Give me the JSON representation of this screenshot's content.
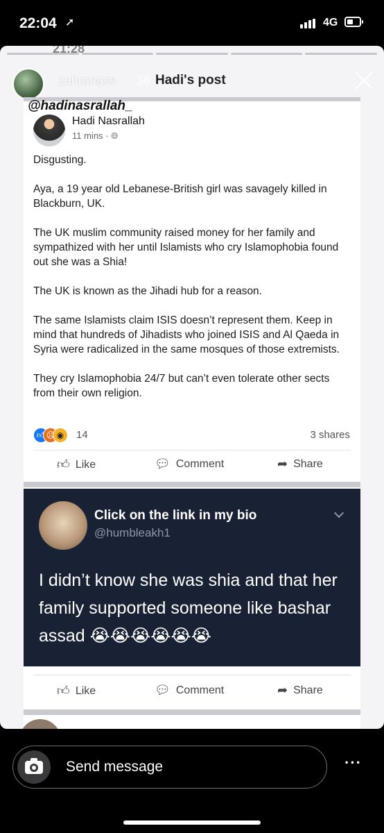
{
  "status_bar": {
    "time": "22:04",
    "network": "4G"
  },
  "story": {
    "username": "zahranass",
    "time": "36",
    "post_title": "Hadi's post",
    "background_time": "21:28"
  },
  "post": {
    "mention": "@hadinasrallah_",
    "author": "Hadi Nasrallah",
    "meta": "11 mins · ",
    "paragraphs": [
      "Disgusting.",
      "Aya, a 19 year old Lebanese-British girl was savagely killed in Blackburn, UK.",
      "The UK muslim community raised money for her family and sympathized with her until Islamists who cry Islamophobia found out she was a Shia!",
      "The UK is known as the Jihadi hub for a reason.",
      "The same Islamists claim ISIS doesn’t represent them. Keep in mind that hundreds of Jihadists who joined ISIS and Al Qaeda in Syria were radicalized in the same mosques of those extremists.",
      "They cry Islamophobia 24/7 but can’t even tolerate other sects from their own religion."
    ],
    "reaction_count": "14",
    "shares": "3 shares",
    "actions": {
      "like": "Like",
      "comment": "Comment",
      "share": "Share"
    }
  },
  "tweet": {
    "name": "Click on the link in my bio",
    "handle": "@humbleakh1",
    "text": "I didn’t know she was shia and that her family supported someone like bashar assad 😭😭😭😭😭😭"
  },
  "comment_actions": {
    "like": "Like",
    "comment": "Comment",
    "share": "Share"
  },
  "composer": {
    "placeholder": "Send message"
  },
  "icons": [
    "location-arrow-icon",
    "signal-icon",
    "battery-icon",
    "close-icon",
    "globe-icon",
    "like-icon",
    "comment-icon",
    "share-icon",
    "chevron-down-icon",
    "camera-icon",
    "more-icon"
  ]
}
